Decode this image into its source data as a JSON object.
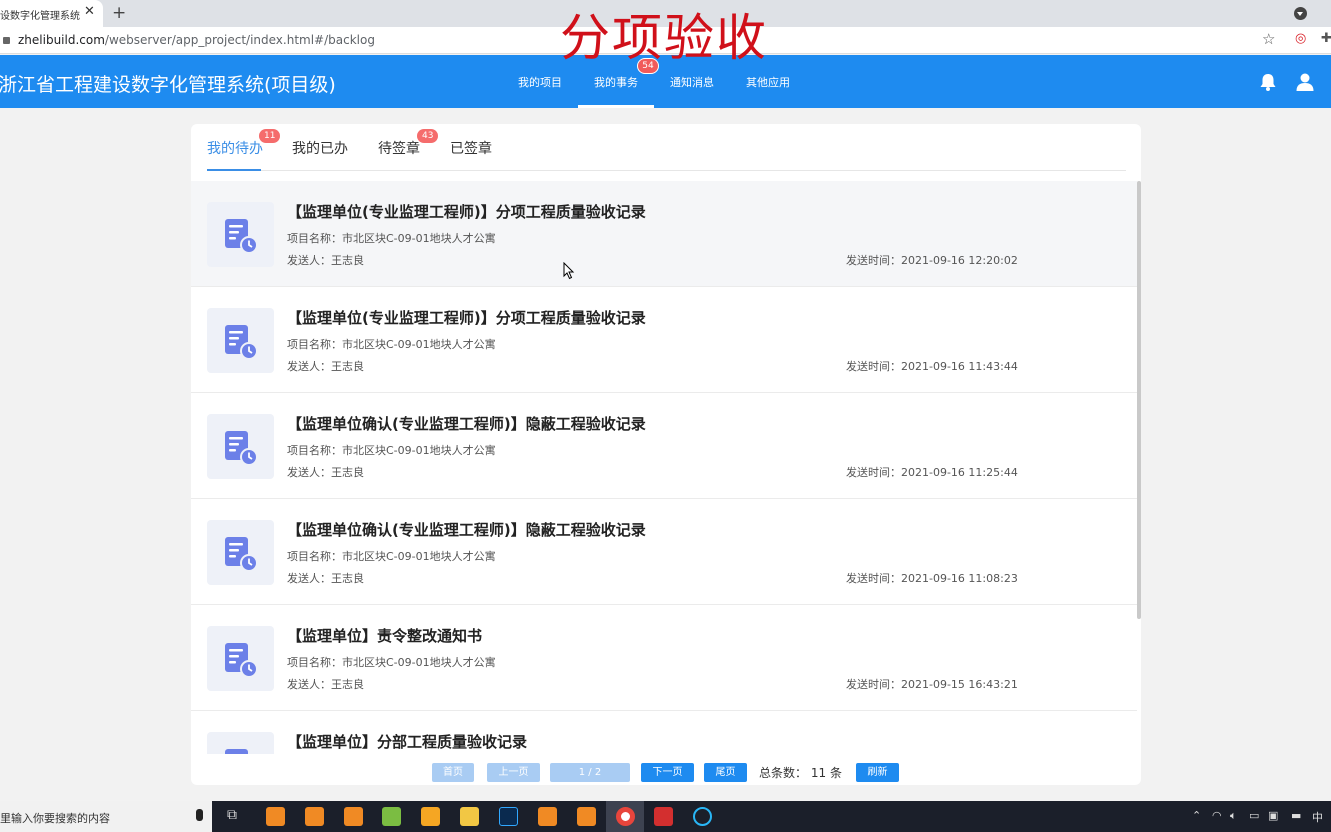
{
  "browser": {
    "tab_title": "设数字化管理系统",
    "tab_close": "✕",
    "new_tab": "+",
    "url_host": "zhelibuild.com",
    "url_path": "/webserver/app_project/index.html#/backlog",
    "star": "☆"
  },
  "overlay_caption": "分项验收",
  "navbar": {
    "system_title": "浙江省工程建设数字化管理系统(项目级)",
    "items": [
      {
        "label": "我的项目"
      },
      {
        "label": "我的事务",
        "badge": "54",
        "active": true
      },
      {
        "label": "通知消息"
      },
      {
        "label": "其他应用"
      }
    ]
  },
  "subtabs": [
    {
      "label": "我的待办",
      "badge": "11",
      "active": true
    },
    {
      "label": "我的已办"
    },
    {
      "label": "待签章",
      "badge": "43"
    },
    {
      "label": "已签章"
    }
  ],
  "items": [
    {
      "title": "【监理单位(专业监理工程师)】分项工程质量验收记录",
      "project": "项目名称：市北区块C-09-01地块人才公寓",
      "sender": "发送人：王志良",
      "time": "发送时间：2021-09-16 12:20:02"
    },
    {
      "title": "【监理单位(专业监理工程师)】分项工程质量验收记录",
      "project": "项目名称：市北区块C-09-01地块人才公寓",
      "sender": "发送人：王志良",
      "time": "发送时间：2021-09-16 11:43:44"
    },
    {
      "title": "【监理单位确认(专业监理工程师)】隐蔽工程验收记录",
      "project": "项目名称：市北区块C-09-01地块人才公寓",
      "sender": "发送人：王志良",
      "time": "发送时间：2021-09-16 11:25:44"
    },
    {
      "title": "【监理单位确认(专业监理工程师)】隐蔽工程验收记录",
      "project": "项目名称：市北区块C-09-01地块人才公寓",
      "sender": "发送人：王志良",
      "time": "发送时间：2021-09-16 11:08:23"
    },
    {
      "title": "【监理单位】责令整改通知书",
      "project": "项目名称：市北区块C-09-01地块人才公寓",
      "sender": "发送人：王志良",
      "time": "发送时间：2021-09-15 16:43:21"
    },
    {
      "title": "【监理单位】分部工程质量验收记录",
      "project": "",
      "sender": "",
      "time": ""
    }
  ],
  "pagination": {
    "first": "首页",
    "prev": "上一页",
    "page_indicator": "1 / 2",
    "next": "下一页",
    "last": "尾页",
    "total_label": "总条数：",
    "total_value": "11",
    "total_unit": "条",
    "refresh": "刷新"
  },
  "taskbar": {
    "search_placeholder": "里输入你要搜索的内容",
    "tray_ime": "中"
  },
  "colors": {
    "brand_blue": "#1e8bf0",
    "badge_red": "#f56c6c",
    "active_tab": "#3a8ee6",
    "overlay_red": "#d0101a"
  }
}
